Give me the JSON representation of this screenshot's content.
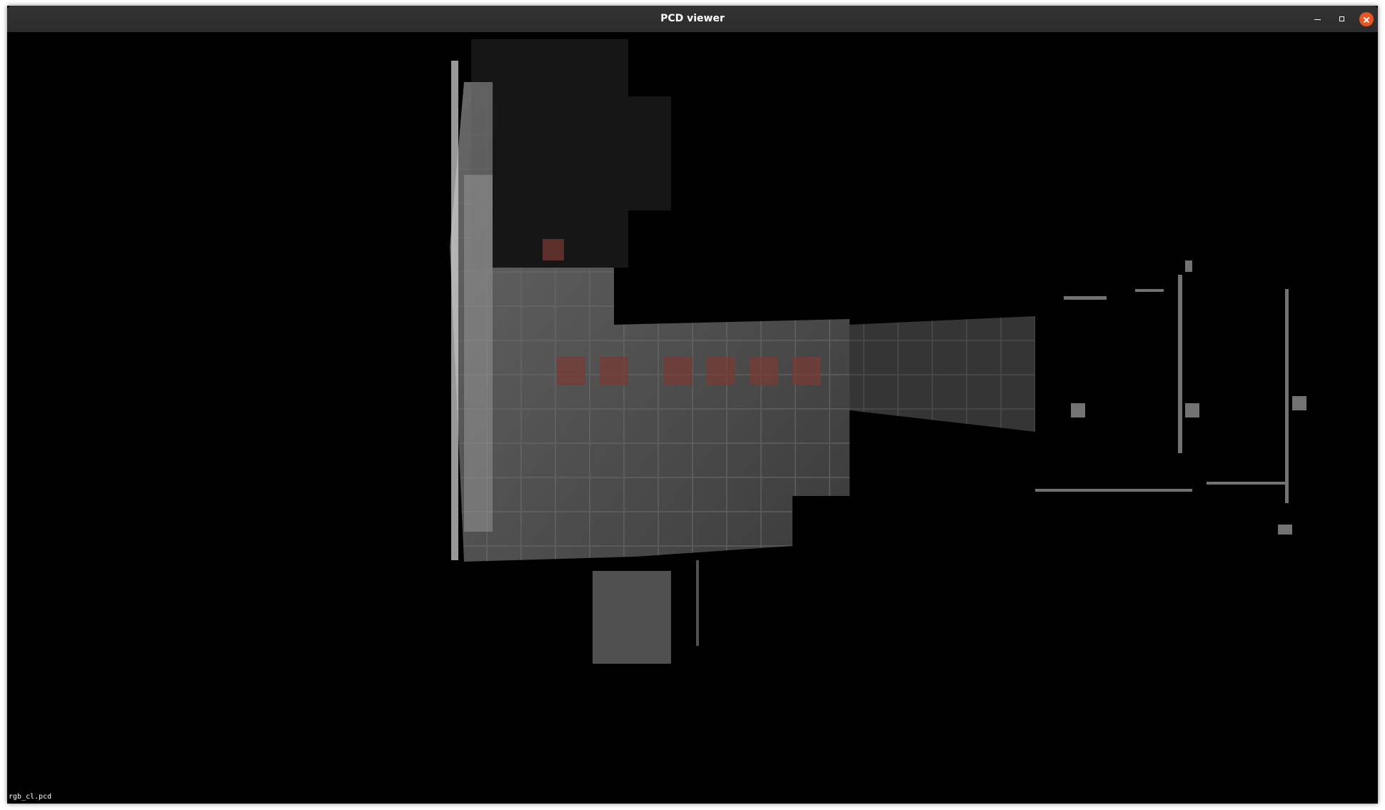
{
  "window": {
    "title": "PCD viewer"
  },
  "viewer": {
    "background_color": "#000000",
    "point_color": "#d0d0d0",
    "overlay_text": "rgb_cl.pcd"
  },
  "icons": {
    "minimize": "minimize-icon",
    "maximize": "maximize-icon",
    "close": "close-icon"
  }
}
